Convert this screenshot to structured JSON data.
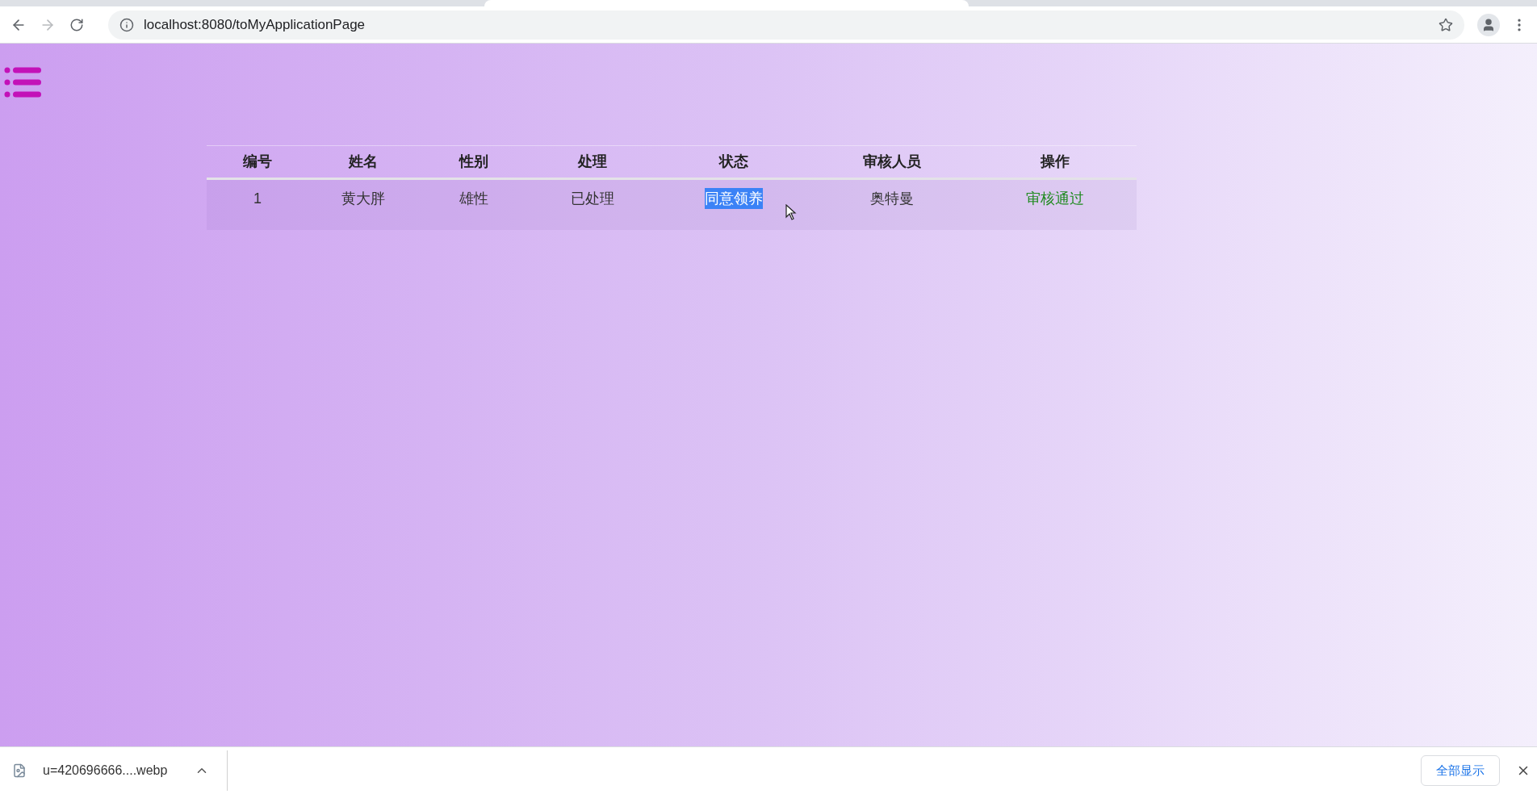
{
  "browser": {
    "url": "localhost:8080/toMyApplicationPage",
    "forward_disabled": true
  },
  "table": {
    "columns": [
      "编号",
      "姓名",
      "性别",
      "处理",
      "状态",
      "审核人员",
      "操作"
    ],
    "rows": [
      {
        "cells": [
          {
            "text": "1",
            "kind": "plain",
            "highlighted": false
          },
          {
            "text": "黄大胖",
            "kind": "plain",
            "highlighted": false
          },
          {
            "text": "雄性",
            "kind": "plain",
            "highlighted": false
          },
          {
            "text": "已处理",
            "kind": "plain",
            "highlighted": false
          },
          {
            "text": "同意领养",
            "kind": "plain",
            "highlighted": true
          },
          {
            "text": "奥特曼",
            "kind": "plain",
            "highlighted": false
          },
          {
            "text": "审核通过",
            "kind": "action",
            "highlighted": false
          }
        ]
      }
    ]
  },
  "download_bar": {
    "file": "u=420696666....webp",
    "show_all_button": "全部显示"
  }
}
